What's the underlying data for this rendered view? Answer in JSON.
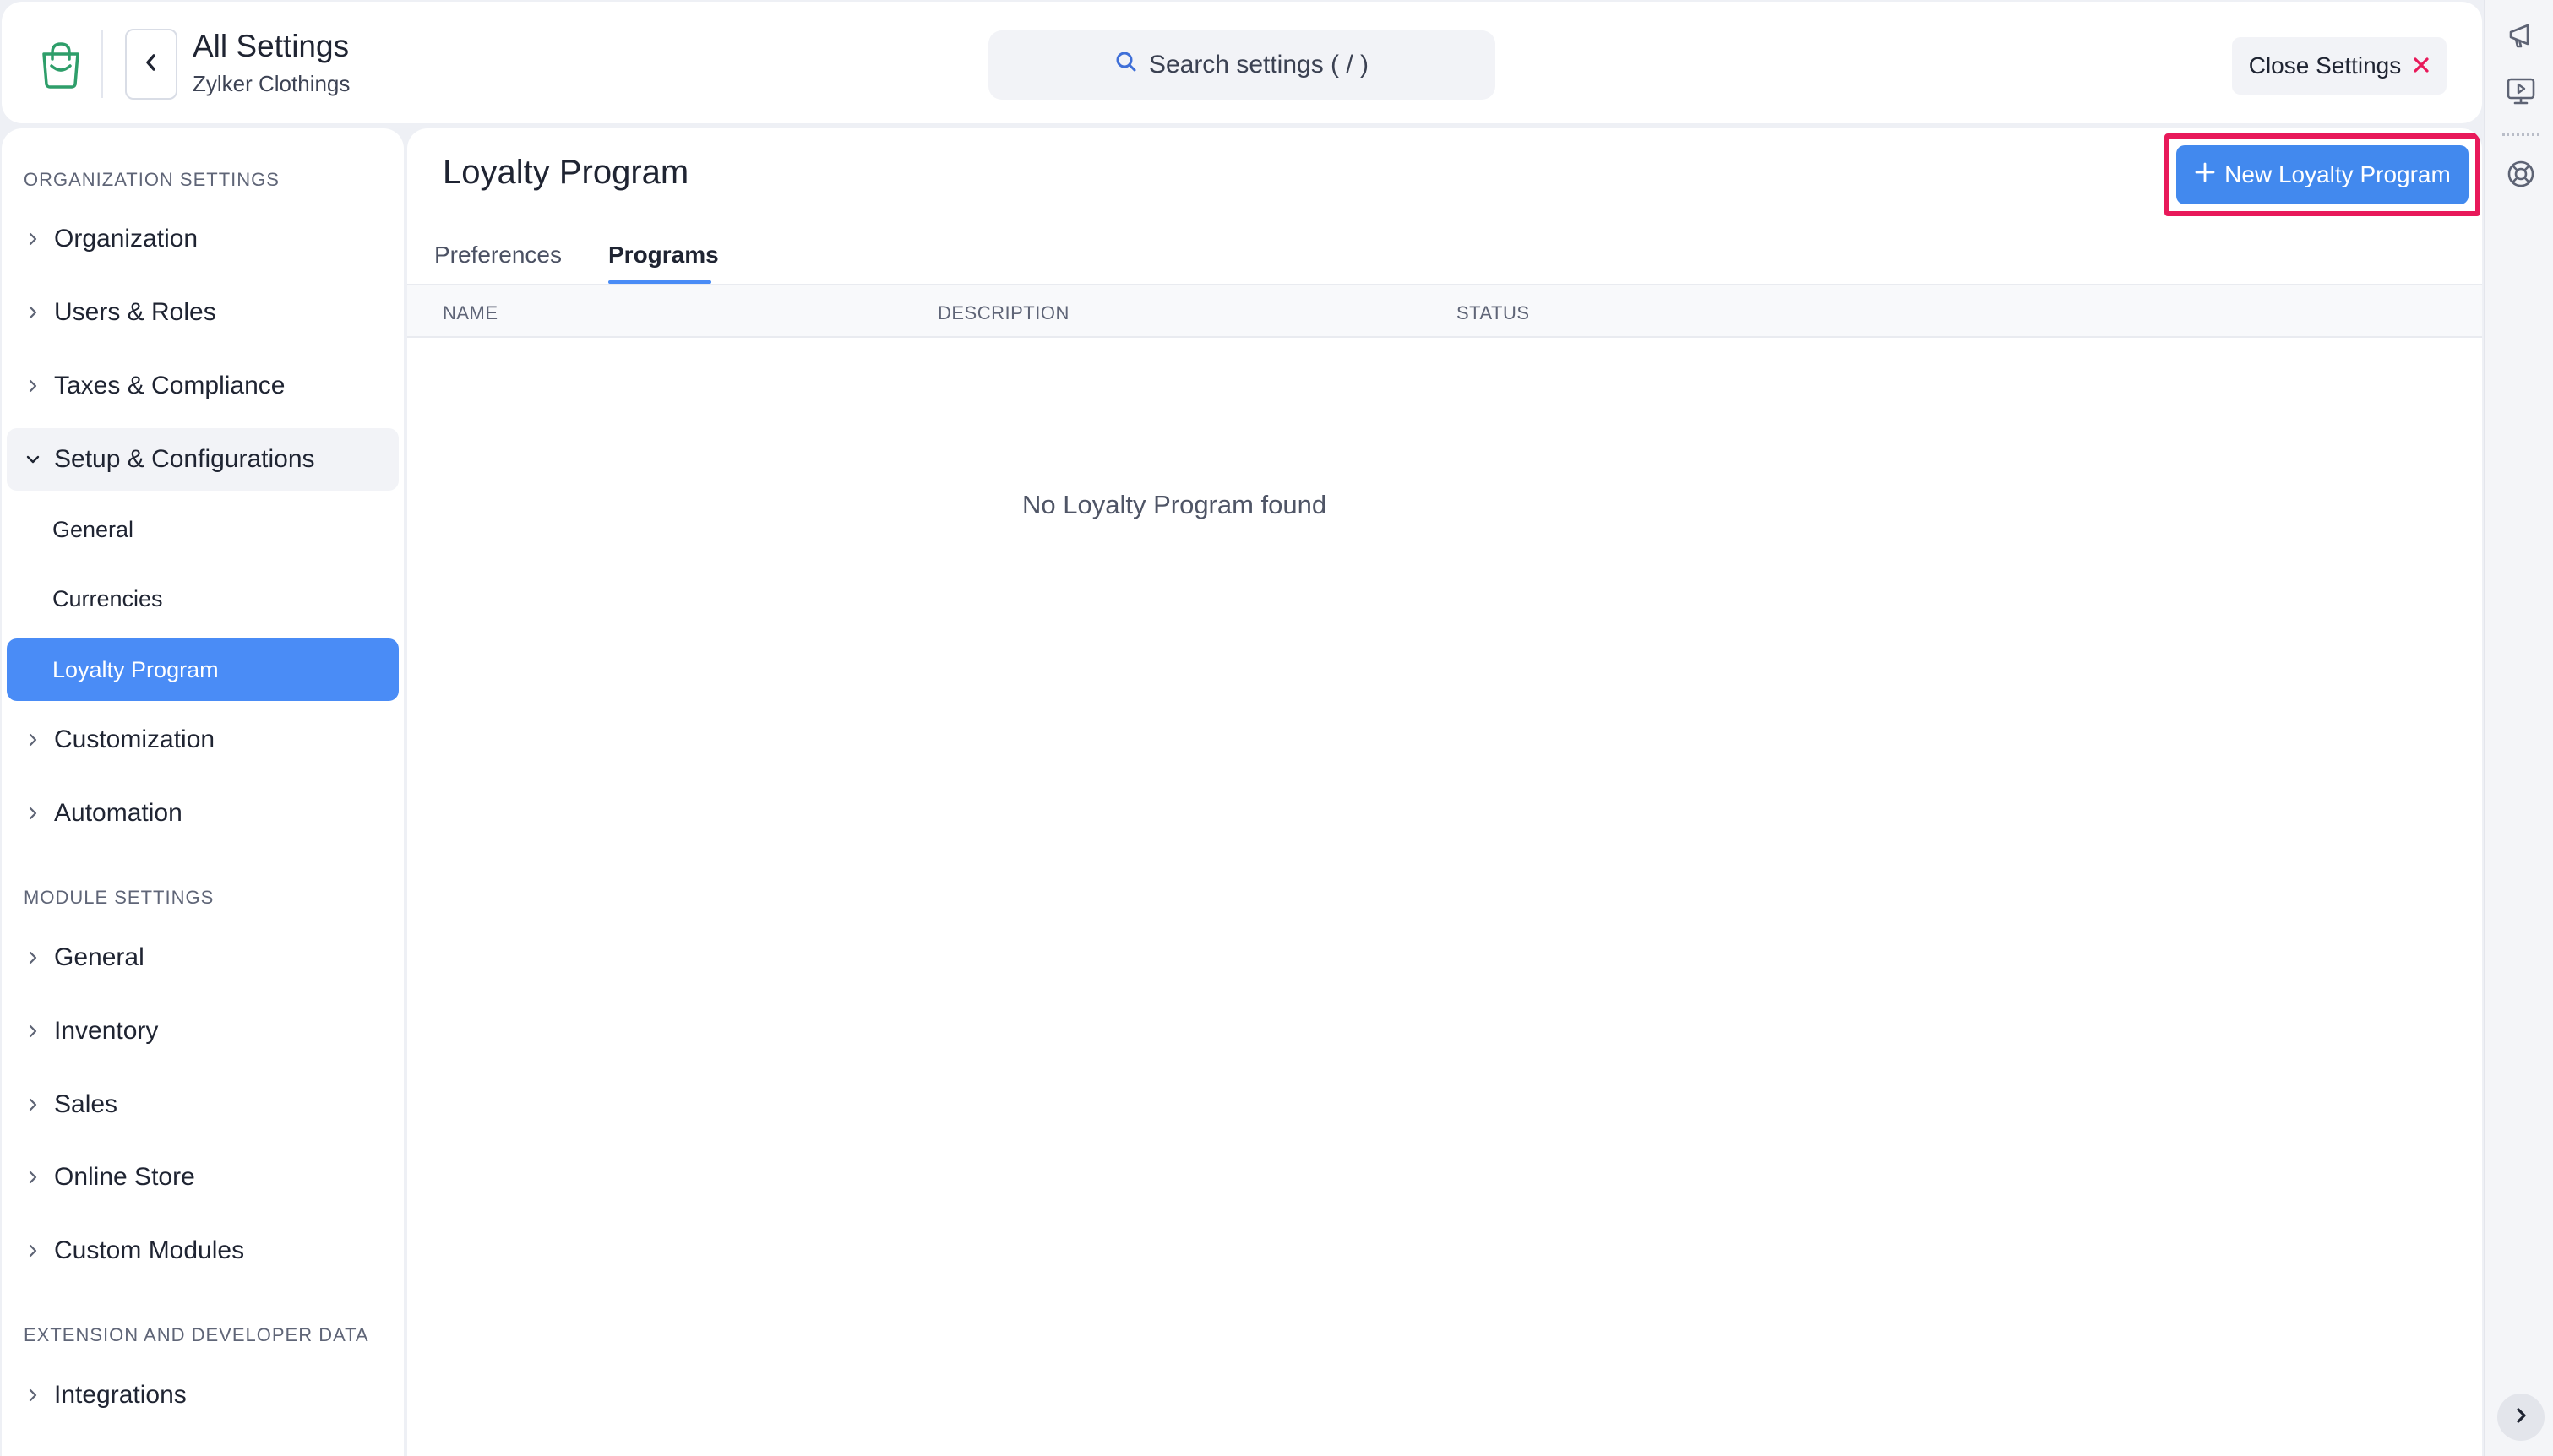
{
  "header": {
    "title": "All Settings",
    "subtitle": "Zylker Clothings",
    "search_placeholder": "Search settings ( / )",
    "close_label": "Close Settings"
  },
  "sidebar": {
    "sections": [
      {
        "label": "ORGANIZATION SETTINGS"
      },
      {
        "label": "MODULE SETTINGS"
      },
      {
        "label": "EXTENSION AND DEVELOPER DATA"
      }
    ],
    "org_items": [
      {
        "label": "Organization"
      },
      {
        "label": "Users & Roles"
      },
      {
        "label": "Taxes & Compliance"
      },
      {
        "label": "Setup & Configurations",
        "expanded": true
      },
      {
        "label": "Customization"
      },
      {
        "label": "Automation"
      }
    ],
    "setup_sub_items": [
      {
        "label": "General"
      },
      {
        "label": "Currencies"
      },
      {
        "label": "Loyalty Program",
        "active": true
      }
    ],
    "module_items": [
      {
        "label": "General"
      },
      {
        "label": "Inventory"
      },
      {
        "label": "Sales"
      },
      {
        "label": "Online Store"
      },
      {
        "label": "Custom Modules"
      }
    ],
    "extension_items": [
      {
        "label": "Integrations"
      }
    ]
  },
  "main": {
    "title": "Loyalty Program",
    "new_button_label": "New Loyalty Program",
    "tabs": [
      {
        "label": "Preferences",
        "active": false
      },
      {
        "label": "Programs",
        "active": true
      }
    ],
    "columns": [
      "NAME",
      "DESCRIPTION",
      "STATUS"
    ],
    "empty_message": "No Loyalty Program found"
  },
  "colors": {
    "accent": "#4a8cf6",
    "highlight_frame": "#e8195a",
    "close_icon": "#e8195a",
    "brand": "#2e9e6a"
  },
  "icons": {
    "brand": "shopping-bag-icon",
    "back": "chevron-left-icon",
    "search": "search-icon",
    "close": "close-icon",
    "add": "plus-icon",
    "rail": [
      "announcement-icon",
      "video-tutorial-icon",
      "support-icon"
    ],
    "rail_expand": "chevron-right-icon"
  }
}
